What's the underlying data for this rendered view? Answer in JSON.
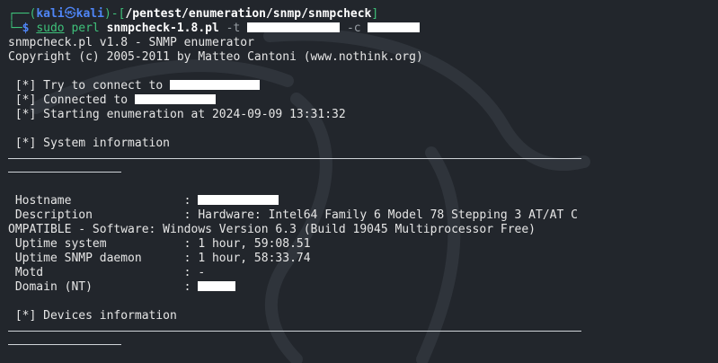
{
  "prompt": {
    "corner_top": "┌──(",
    "user": "kali",
    "at": "㉿",
    "host": "kali",
    "path_open": ")-[",
    "path": "/pentest/enumeration/snmp/snmpcheck",
    "path_close": "]",
    "corner_bottom": "└─",
    "dollar": "$",
    "cmd_sudo": "sudo",
    "cmd_perl": "perl",
    "cmd_script": "snmpcheck-1.8.pl",
    "flag_t": "-t",
    "flag_c": "-c"
  },
  "header": {
    "banner": "snmpcheck.pl v1.8 - SNMP enumerator",
    "copyright": "Copyright (c) 2005-2011 by Matteo Cantoni (www.nothink.org)"
  },
  "status": {
    "try_connect": " [*] Try to connect to ",
    "connected": " [*] Connected to ",
    "starting": " [*] Starting enumeration at 2024-09-09 13:31:32"
  },
  "sections": {
    "system_info": " [*] System information",
    "devices_info": " [*] Devices information"
  },
  "system": {
    "hostname_label": " Hostname                : ",
    "description_label": " Description             : Hardware: Intel64 Family 6 Model 78 Stepping 3 AT/AT C",
    "description_wrap": "OMPATIBLE - Software: Windows Version 6.3 (Build 19045 Multiprocessor Free)",
    "uptime_system": " Uptime system           : 1 hour, 59:08.51",
    "uptime_snmp": " Uptime SNMP daemon      : 1 hour, 58:33.74",
    "motd": " Motd                    : -",
    "domain_label": " Domain (NT)             : "
  }
}
